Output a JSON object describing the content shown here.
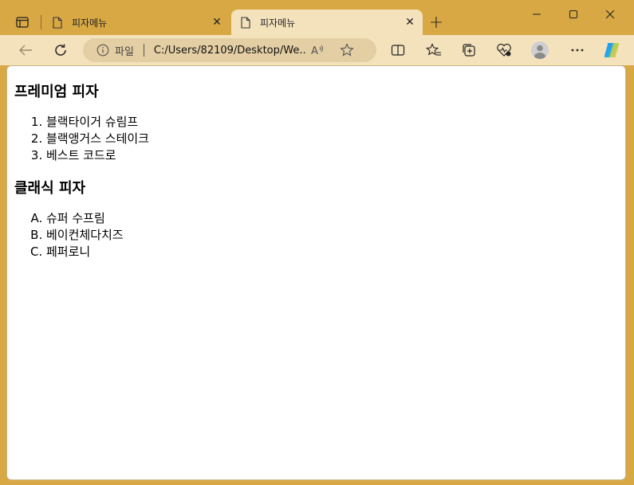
{
  "tabs": [
    {
      "title": "피자메뉴",
      "active": false
    },
    {
      "title": "피자메뉴",
      "active": true
    }
  ],
  "window_controls": {
    "minimize": "—",
    "maximize": "☐",
    "close": "✕"
  },
  "newtab_label": "+",
  "address": {
    "label": "파일",
    "url": "C:/Users/82109/Desktop/We..."
  },
  "page": {
    "section1": {
      "heading": "프레미엄 피자",
      "items": [
        "블랙타이거 슈림프",
        "블랙앵거스 스테이크",
        "베스트 코드로"
      ]
    },
    "section2": {
      "heading": "클래식 피자",
      "items": [
        "슈퍼 수프림",
        "베이컨체다치즈",
        "페퍼로니"
      ]
    }
  },
  "colors": {
    "frame": "#d8a844",
    "active_tab": "#f4e2bd",
    "toolbar": "#f4e2bd",
    "address_bar": "#e4cfa4"
  },
  "icons": [
    "tab-actions-icon",
    "page-icon",
    "close-icon",
    "plus-icon",
    "back-arrow-icon",
    "refresh-icon",
    "info-icon",
    "read-aloud-icon",
    "favorite-star-icon",
    "split-screen-icon",
    "favorites-icon",
    "collections-icon",
    "health-icon",
    "profile-icon",
    "more-icon",
    "copilot-icon"
  ]
}
